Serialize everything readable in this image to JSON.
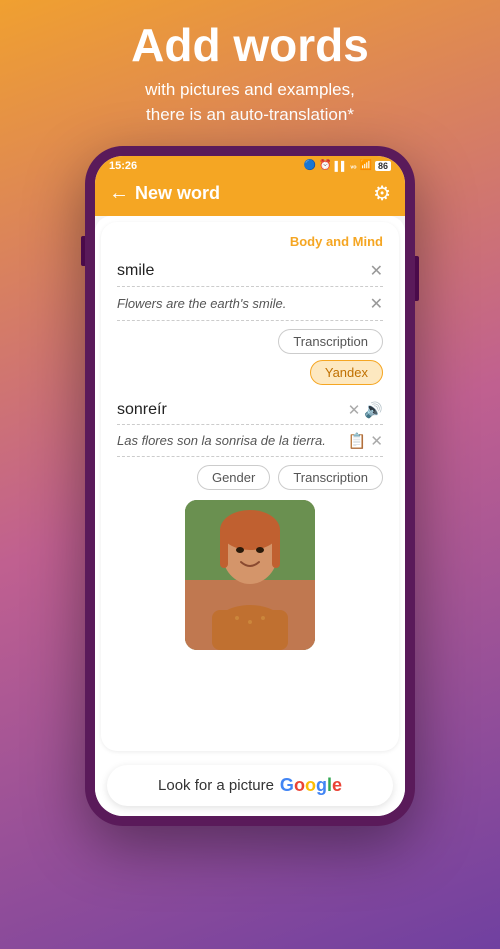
{
  "header": {
    "title": "Add words",
    "subtitle_line1": "with pictures and examples,",
    "subtitle_line2": "there is an auto-translation*"
  },
  "status_bar": {
    "time": "15:26",
    "icons": "🔵 ⏰ ▌▌ᵥₒ 🔵 🔋"
  },
  "top_bar": {
    "title": "New word",
    "back_label": "←",
    "gear_label": "⚙"
  },
  "card": {
    "category": "Body and Mind",
    "word": "smile",
    "example": "Flowers are the earth's smile.",
    "transcription_btn": "Transcription",
    "yandex_btn": "Yandex",
    "translation": "sonreír",
    "translation_example": "Las flores son la sonrisa de la tierra.",
    "gender_btn": "Gender",
    "transcription_btn2": "Transcription"
  },
  "google_bar": {
    "text": "Look for a picture",
    "google": "Google"
  }
}
